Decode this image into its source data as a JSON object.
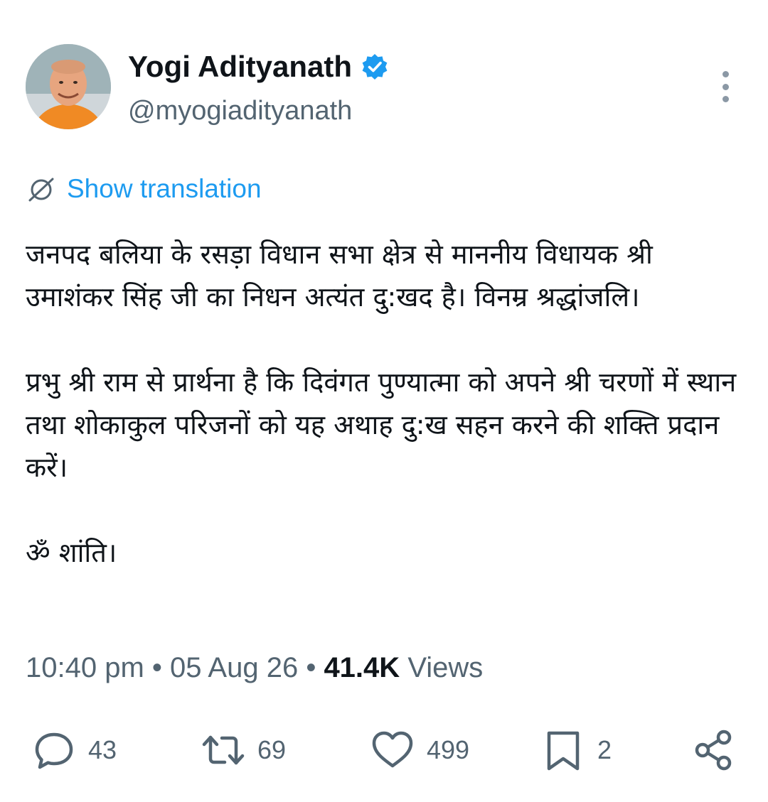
{
  "author": {
    "display_name": "Yogi Adityanath",
    "handle": "@myogiadityanath",
    "verified": true,
    "avatar_icon": "profile-photo"
  },
  "translate": {
    "label": "Show translation",
    "icon": "globe-translate-icon"
  },
  "tweet": {
    "paragraphs": [
      "जनपद बलिया के रसड़ा विधान सभा क्षेत्र से माननीय विधायक श्री उमाशंकर सिंह जी का निधन अत्यंत दु:खद है। विनम्र श्रद्धांजलि।",
      "प्रभु श्री राम से प्रार्थना है कि दिवंगत पुण्यात्मा को अपने श्री चरणों में स्थान तथा शोकाकुल परिजनों को यह अथाह दु:ख सहन करने की शक्ति प्रदान करें।",
      "ॐ शांति।"
    ]
  },
  "meta": {
    "time": "10:40 pm",
    "separator": " • ",
    "date": "05 Aug 26",
    "views_count": "41.4K",
    "views_label": "Views"
  },
  "actions": {
    "replies": "43",
    "reposts": "69",
    "likes": "499",
    "bookmarks": "2"
  },
  "colors": {
    "text": "#0f1419",
    "secondary": "#536471",
    "link": "#1d9bf0",
    "verified": "#1d9bf0"
  }
}
